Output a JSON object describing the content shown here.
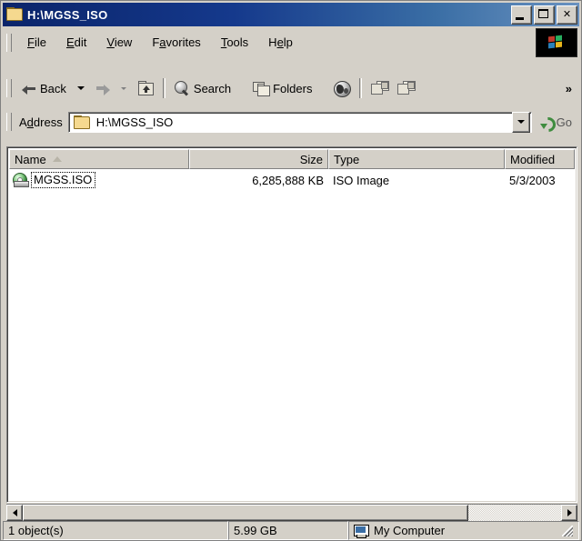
{
  "window": {
    "title": "H:\\MGSS_ISO",
    "title_icon": "folder-icon",
    "minimize_label": "_",
    "maximize_label": "□",
    "close_label": "✕"
  },
  "menu": {
    "items": [
      {
        "pre": "",
        "accel": "F",
        "post": "ile"
      },
      {
        "pre": "",
        "accel": "E",
        "post": "dit"
      },
      {
        "pre": "",
        "accel": "V",
        "post": "iew"
      },
      {
        "pre": "F",
        "accel": "a",
        "post": "vorites"
      },
      {
        "pre": "",
        "accel": "T",
        "post": "ools"
      },
      {
        "pre": "H",
        "accel": "e",
        "post": "lp"
      }
    ],
    "logo": "windows-flag-logo"
  },
  "toolbar": {
    "back_label": "Back",
    "forward_label": "",
    "up_label": "",
    "search_label": "Search",
    "folders_label": "Folders",
    "history_label": "",
    "move_to_label": "",
    "copy_to_label": "",
    "overflow_label": "»"
  },
  "address": {
    "label": "Address",
    "value": "H:\\MGSS_ISO",
    "go_label": "Go"
  },
  "columns": [
    {
      "label": "Name",
      "sorted": true,
      "align": "left",
      "width": 198
    },
    {
      "label": "Size",
      "sorted": false,
      "align": "right",
      "width": 153
    },
    {
      "label": "Type",
      "sorted": false,
      "align": "left",
      "width": 194
    },
    {
      "label": "Modified",
      "sorted": false,
      "align": "left",
      "width": 79
    }
  ],
  "files": [
    {
      "name": "MGSS.ISO",
      "size": "6,285,888 KB",
      "type": "ISO Image",
      "modified": "5/3/2003",
      "icon": "iso-disc-icon",
      "focused": true
    }
  ],
  "status": {
    "objects": "1 object(s)",
    "size": "5.99 GB",
    "location": "My Computer",
    "location_icon": "my-computer-icon"
  },
  "colors": {
    "titlebar_start": "#0a246a",
    "titlebar_end": "#6a92c0",
    "face": "#d4d0c8",
    "listview_bg": "#ffffff",
    "text": "#000000"
  }
}
